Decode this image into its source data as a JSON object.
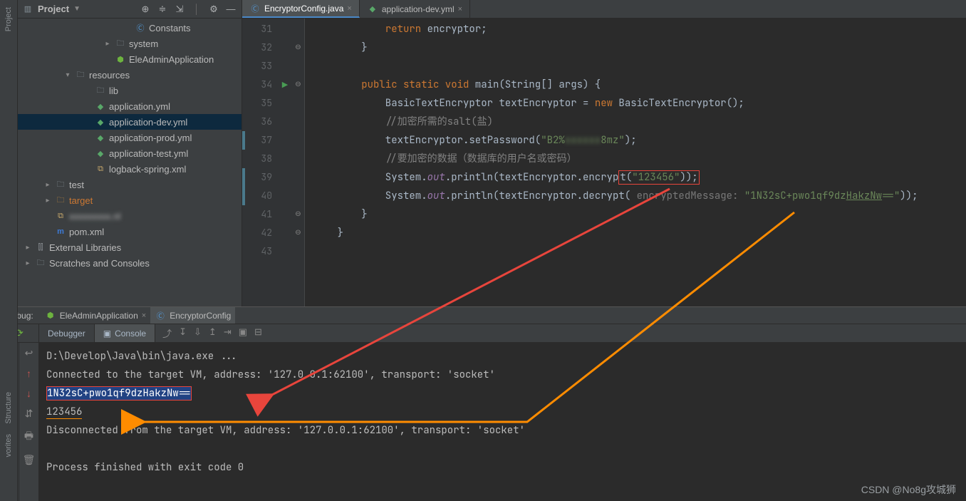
{
  "sidebar": {
    "title": "Project",
    "toolbar_icons": [
      "target",
      "collapse",
      "expand",
      "divider",
      "gear",
      "minimize"
    ],
    "tree": [
      {
        "indent": 10,
        "icon": "class",
        "label": "Constants"
      },
      {
        "indent": 8,
        "arrow": "closed",
        "icon": "folder",
        "label": "system"
      },
      {
        "indent": 8,
        "icon": "spring",
        "label": "EleAdminApplication"
      },
      {
        "indent": 4,
        "arrow": "open",
        "icon": "folder",
        "label": "resources"
      },
      {
        "indent": 6,
        "icon": "folder",
        "label": "lib"
      },
      {
        "indent": 6,
        "icon": "yml",
        "label": "application.yml"
      },
      {
        "indent": 6,
        "icon": "yml",
        "label": "application-dev.yml",
        "selected": true
      },
      {
        "indent": 6,
        "icon": "yml",
        "label": "application-prod.yml"
      },
      {
        "indent": 6,
        "icon": "yml",
        "label": "application-test.yml"
      },
      {
        "indent": 6,
        "icon": "xml",
        "label": "logback-spring.xml"
      },
      {
        "indent": 2,
        "arrow": "closed",
        "icon": "folder",
        "label": "test"
      },
      {
        "indent": 2,
        "arrow": "closed",
        "icon": "folder-orange",
        "label": "target",
        "labelClass": "orange"
      },
      {
        "indent": 2,
        "icon": "xml",
        "label": "xxxxxxxxx.nl",
        "labelClass": "blur"
      },
      {
        "indent": 2,
        "icon": "pom",
        "label": "pom.xml"
      },
      {
        "indent": 0,
        "arrow": "closed",
        "icon": "lib",
        "label": "External Libraries"
      },
      {
        "indent": 0,
        "arrow": "closed",
        "icon": "folder",
        "label": "Scratches and Consoles"
      }
    ]
  },
  "left_labels": {
    "project": "Project",
    "structure": "Structure",
    "favorites": "vorites"
  },
  "editor": {
    "tabs": [
      {
        "icon": "class",
        "label": "EncryptorConfig.java",
        "active": true
      },
      {
        "icon": "yml",
        "label": "application-dev.yml",
        "active": false
      }
    ],
    "line_start": 31,
    "lines": [
      {
        "n": 31,
        "html": "            <span class='kw'>return</span> encryptor;"
      },
      {
        "n": 32,
        "fold": "⊖",
        "html": "        }"
      },
      {
        "n": 33,
        "html": ""
      },
      {
        "n": 34,
        "run": "▶",
        "fold": "⊖",
        "html": "        <span class='kw'>public static void</span> main(String[] args) {"
      },
      {
        "n": 35,
        "html": "            BasicTextEncryptor textEncryptor = <span class='kw'>new</span> BasicTextEncryptor();"
      },
      {
        "n": 36,
        "html": "            <span class='com'>//加密所需的salt(盐)</span>"
      },
      {
        "n": 37,
        "chg": true,
        "html": "            textEncryptor.setPassword(<span class='str'>\"B2%</span><span class='str blur2'>xxxxxx</span><span class='str'>8mz\"</span>);"
      },
      {
        "n": 38,
        "html": "            <span class='com'>//要加密的数据（数据库的用户名或密码）</span>"
      },
      {
        "n": 39,
        "chg": true,
        "html": "            System.<span class='fld'>out</span>.println(textEncryptor.encryp<span class='red-box'>t(<span class='str'>\"123456\"</span>));</span>"
      },
      {
        "n": 40,
        "chg": true,
        "html": "            System.<span class='fld'>out</span>.println(textEncryptor.decrypt( <span class='hint'>encryptedMessage:</span> <span class='str'>\"1N32sC+pwo1qf9dz<u>HakzNw</u>==\"</span>));"
      },
      {
        "n": 41,
        "fold": "⊖",
        "html": "        }"
      },
      {
        "n": 42,
        "fold": "⊖",
        "html": "    }"
      },
      {
        "n": 43,
        "html": ""
      }
    ]
  },
  "debug": {
    "label": "Debug:",
    "runConfigs": [
      {
        "icon": "spring",
        "label": "EleAdminApplication",
        "active": false
      },
      {
        "icon": "class",
        "label": "EncryptorConfig",
        "active": true
      }
    ],
    "tabs": [
      {
        "label": "Debugger",
        "active": false
      },
      {
        "icon": "▣",
        "label": "Console",
        "active": true
      }
    ],
    "console": [
      {
        "text": "D:\\Develop\\Java\\bin\\java.exe ..."
      },
      {
        "text": "Connected to the target VM, address: '127.0.0.1:62100', transport: 'socket'"
      },
      {
        "selected": true,
        "text": "1N32sC+pwo1qf9dzHakzNw=="
      },
      {
        "orange": true,
        "text": "123456"
      },
      {
        "text": "Disconnected from the target VM, address: '127.0.0.1:62100', transport: 'socket'"
      },
      {
        "text": ""
      },
      {
        "text": "Process finished with exit code 0"
      }
    ]
  },
  "watermark": "CSDN @No8g攻城狮"
}
